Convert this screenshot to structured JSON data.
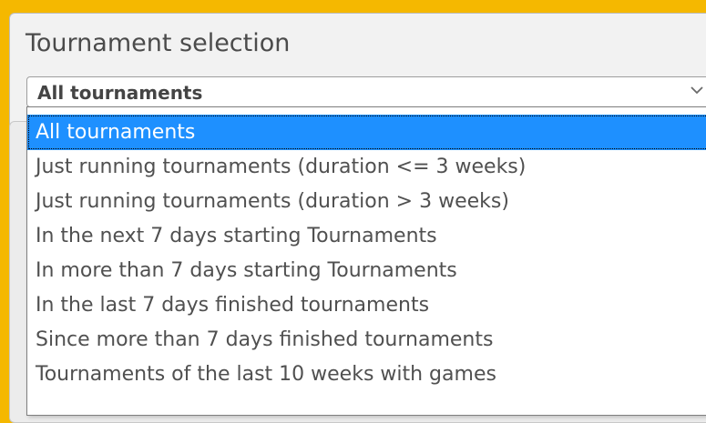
{
  "section": {
    "title": "Tournament selection"
  },
  "select": {
    "current_value": "All tournaments",
    "chevron_icon": "chevron-down-icon",
    "options": [
      {
        "label": "All tournaments",
        "selected": true
      },
      {
        "label": "Just running tournaments (duration <= 3 weeks)",
        "selected": false
      },
      {
        "label": "Just running tournaments (duration > 3 weeks)",
        "selected": false
      },
      {
        "label": "In the next 7 days starting Tournaments",
        "selected": false
      },
      {
        "label": "In more than 7 days starting Tournaments",
        "selected": false
      },
      {
        "label": "In the last 7 days finished tournaments",
        "selected": false
      },
      {
        "label": "Since more than 7 days finished tournaments",
        "selected": false
      },
      {
        "label": "Tournaments of the last 10 weeks with games",
        "selected": false
      }
    ]
  },
  "colors": {
    "background": "#f5b800",
    "selected_option": "#1e90ff"
  }
}
